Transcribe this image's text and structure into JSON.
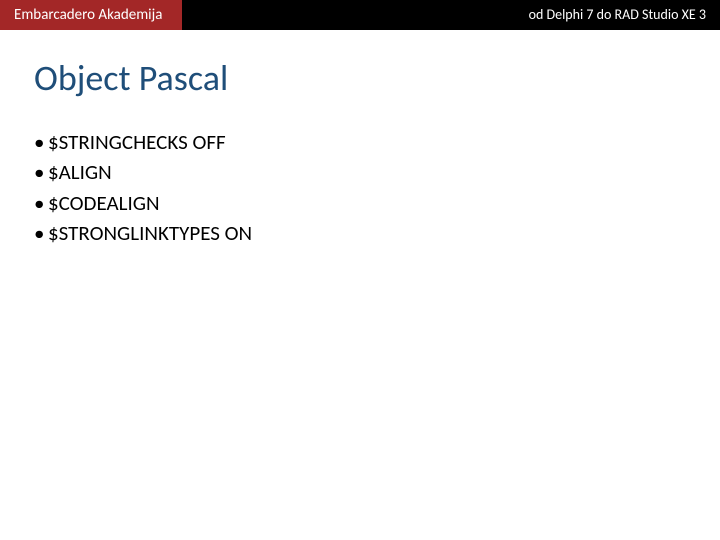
{
  "header": {
    "left": "Embarcadero Akademija",
    "right": "od Delphi 7 do RAD Studio XE 3"
  },
  "title": "Object Pascal",
  "bullets": [
    "$STRINGCHECKS OFF",
    "$ALIGN",
    "$CODEALIGN",
    "$STRONGLINKTYPES ON"
  ],
  "colors": {
    "header_left_bg": "#a32727",
    "header_bg": "#000000",
    "title_color": "#1f4e79"
  }
}
